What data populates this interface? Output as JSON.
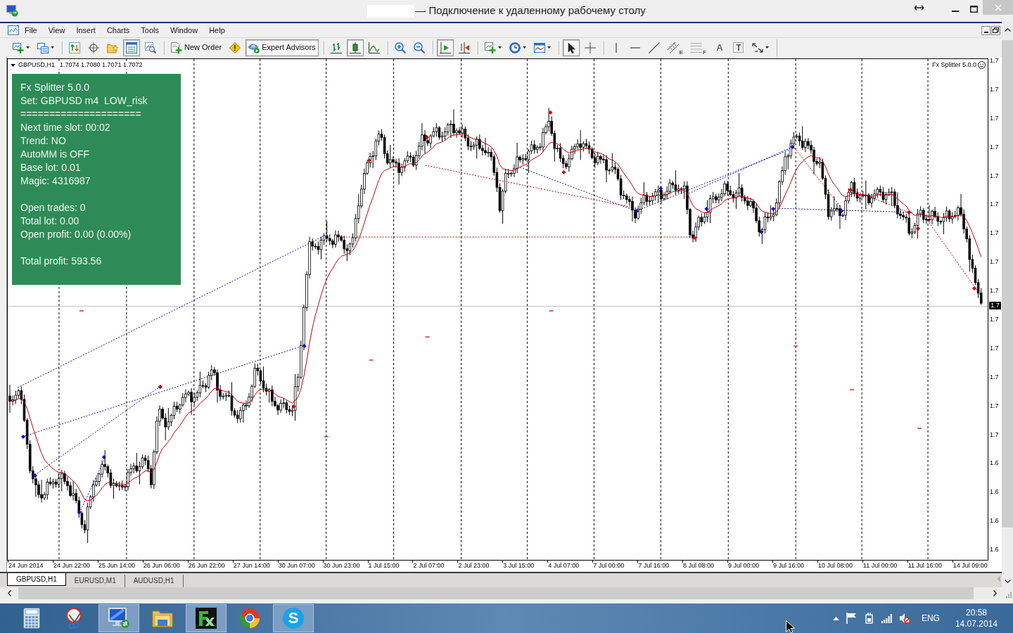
{
  "window": {
    "title": "— Подключение к удаленному рабочему столу",
    "title_redacted": true
  },
  "menu": {
    "items": [
      "File",
      "View",
      "Insert",
      "Charts",
      "Tools",
      "Window",
      "Help"
    ]
  },
  "toolbar": {
    "groups": [
      [
        {
          "kind": "chart",
          "pressed": false
        },
        {
          "kind": "profiles",
          "pressed": false
        }
      ],
      [
        {
          "kind": "market",
          "pressed": false
        },
        {
          "kind": "data",
          "pressed": false
        },
        {
          "kind": "navigator",
          "pressed": false
        },
        {
          "kind": "terminal",
          "pressed": true
        },
        {
          "kind": "tester",
          "pressed": false
        }
      ],
      [
        {
          "kind": "order",
          "label": "New Order",
          "pressed": false
        },
        {
          "kind": "editor",
          "pressed": false
        },
        {
          "kind": "experts",
          "label": "Expert Advisors",
          "pressed": true
        }
      ],
      [
        {
          "kind": "bars",
          "pressed": false
        },
        {
          "kind": "candles",
          "pressed": true
        },
        {
          "kind": "line",
          "pressed": false
        }
      ],
      [
        {
          "kind": "zoomin",
          "pressed": false
        },
        {
          "kind": "zoomout",
          "pressed": false
        }
      ],
      [
        {
          "kind": "autoscroll",
          "pressed": true
        },
        {
          "kind": "shift",
          "pressed": false
        }
      ],
      [
        {
          "kind": "indicators",
          "pressed": false
        },
        {
          "kind": "periods",
          "pressed": false
        },
        {
          "kind": "templates",
          "pressed": false
        }
      ],
      [
        {
          "kind": "cursor",
          "pressed": true
        },
        {
          "kind": "crosshair",
          "pressed": false
        }
      ],
      [
        {
          "kind": "vline",
          "pressed": false
        },
        {
          "kind": "hline",
          "pressed": false
        },
        {
          "kind": "trend",
          "pressed": false
        },
        {
          "kind": "channel",
          "glyph": "E",
          "pressed": false
        },
        {
          "kind": "fibo",
          "glyph": "F",
          "pressed": false
        },
        {
          "kind": "text",
          "glyph": "A",
          "pressed": false
        },
        {
          "kind": "label",
          "glyph": "T",
          "pressed": false
        },
        {
          "kind": "arrows",
          "pressed": false
        }
      ]
    ]
  },
  "chart": {
    "symbol": "GBPUSD,H1",
    "quotes": "1.7074 1.7080 1.7071 1.7072",
    "expert": "Fx Splitter 5.0.0",
    "info_panel": {
      "groups": [
        [
          "Fx Splitter 5.0.0",
          "Set: GBPUSD m4  LOW_risk",
          "=====================",
          "Next time slot: 00:02",
          "Trend: NO",
          "AutoMM is OFF",
          "Base lot: 0.01",
          "Magic: 4316987"
        ],
        [
          "Open trades: 0",
          "Total lot: 0.00",
          "Open profit: 0.00 (0.00%)"
        ],
        [
          "Total profit: 593.56"
        ]
      ]
    },
    "price_axis": {
      "labels": [
        "1.7",
        "1.7",
        "1.7",
        "1.7",
        "1.7",
        "1.7",
        "1.7",
        "1.7",
        "1.7",
        "1.7",
        "1.7",
        "1.7",
        "1.7",
        "1.7",
        "1.6",
        "1.6",
        "1.6",
        "1.6"
      ],
      "current": "1.7"
    },
    "time_axis": {
      "labels": [
        "24 Jun 2014",
        "24 Jun 22:00",
        "25 Jun 14:00",
        "26 Jun 06:00",
        "26 Jun 22:00",
        "27 Jun 14:00",
        "30 Jun 07:00",
        "30 Jun 23:00",
        "1 Jul 15:00",
        "2 Jul 07:00",
        "2 Jul 23:00",
        "3 Jul 15:00",
        "4 Jul 07:00",
        "7 Jul 00:00",
        "7 Jul 16:00",
        "8 Jul 08:00",
        "9 Jul 00:00",
        "9 Jul 16:00",
        "10 Jul 08:00",
        "11 Jul 00:00",
        "11 Jul 16:00",
        "14 Jul 09:00"
      ]
    }
  },
  "tabs": [
    {
      "label": "GBPUSD,H1",
      "selected": true
    },
    {
      "label": "EURUSD,M1",
      "selected": false
    },
    {
      "label": "AUDUSD,H1",
      "selected": false
    }
  ],
  "taskbar": {
    "apps": [
      {
        "kind": "calculator",
        "open": false
      },
      {
        "kind": "snipping",
        "open": false
      },
      {
        "kind": "remote",
        "open": true
      },
      {
        "kind": "explorer",
        "open": false
      },
      {
        "kind": "fx",
        "open": true
      },
      {
        "kind": "chrome",
        "open": false
      },
      {
        "kind": "skype",
        "glyph": "S",
        "open": true
      }
    ],
    "tray": {
      "language": "ENG",
      "time": "20:58",
      "date": "14.07.2014"
    }
  }
}
